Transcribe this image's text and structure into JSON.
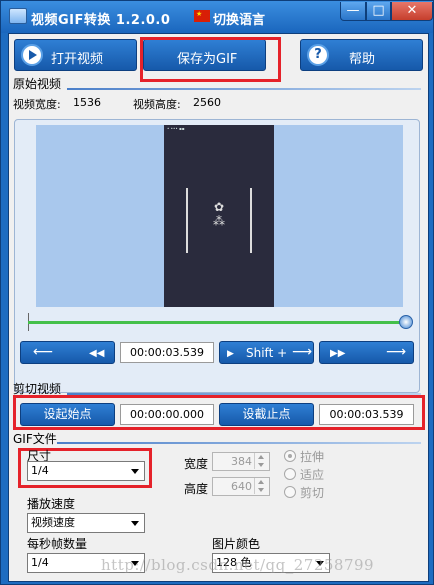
{
  "window": {
    "title": "视频GIF转换 1.2.0.0",
    "language_button": "切换语言",
    "controls": {
      "minimize": "—",
      "maximize": "□",
      "close": "✕"
    }
  },
  "toolbar": {
    "open_video": "打开视频",
    "save_gif": "保存为GIF",
    "help": "帮助"
  },
  "original_video": {
    "section_title": "原始视频",
    "width_label": "视频宽度:",
    "width_value": "1536",
    "height_label": "视频高度:",
    "height_value": "2560",
    "position_fraction": 1.0
  },
  "navigation": {
    "back_arrow": "⟵",
    "rewind_icon": "◀◀",
    "current_time": "00:00:03.539",
    "shift_label": "Shift +",
    "shift_arrow": "⟶",
    "forward_icon": "▶▶",
    "forward_arrow": "⟶"
  },
  "clip": {
    "section_title": "剪切视频",
    "set_start": "设起始点",
    "start_time": "00:00:00.000",
    "set_end": "设截止点",
    "end_time": "00:00:03.539"
  },
  "gif": {
    "section_title": "GIF文件",
    "size_label": "尺寸",
    "size_value": "1/4",
    "width_label": "宽度",
    "width_value": "384",
    "height_label": "高度",
    "height_value": "640",
    "scale_modes": [
      "拉伸",
      "适应",
      "剪切"
    ],
    "selected_scale_mode": "拉伸",
    "speed_label": "播放速度",
    "speed_value": "视频速度",
    "fps_label": "每秒帧数量",
    "fps_value": "1/4",
    "color_label": "图片颜色",
    "color_value": "128 色"
  },
  "watermark": "http://blog.csdn.net/qq_27258799",
  "colors": {
    "accent": "#1d6cc1",
    "highlight": "#e5222a",
    "slider": "#44c04a"
  }
}
